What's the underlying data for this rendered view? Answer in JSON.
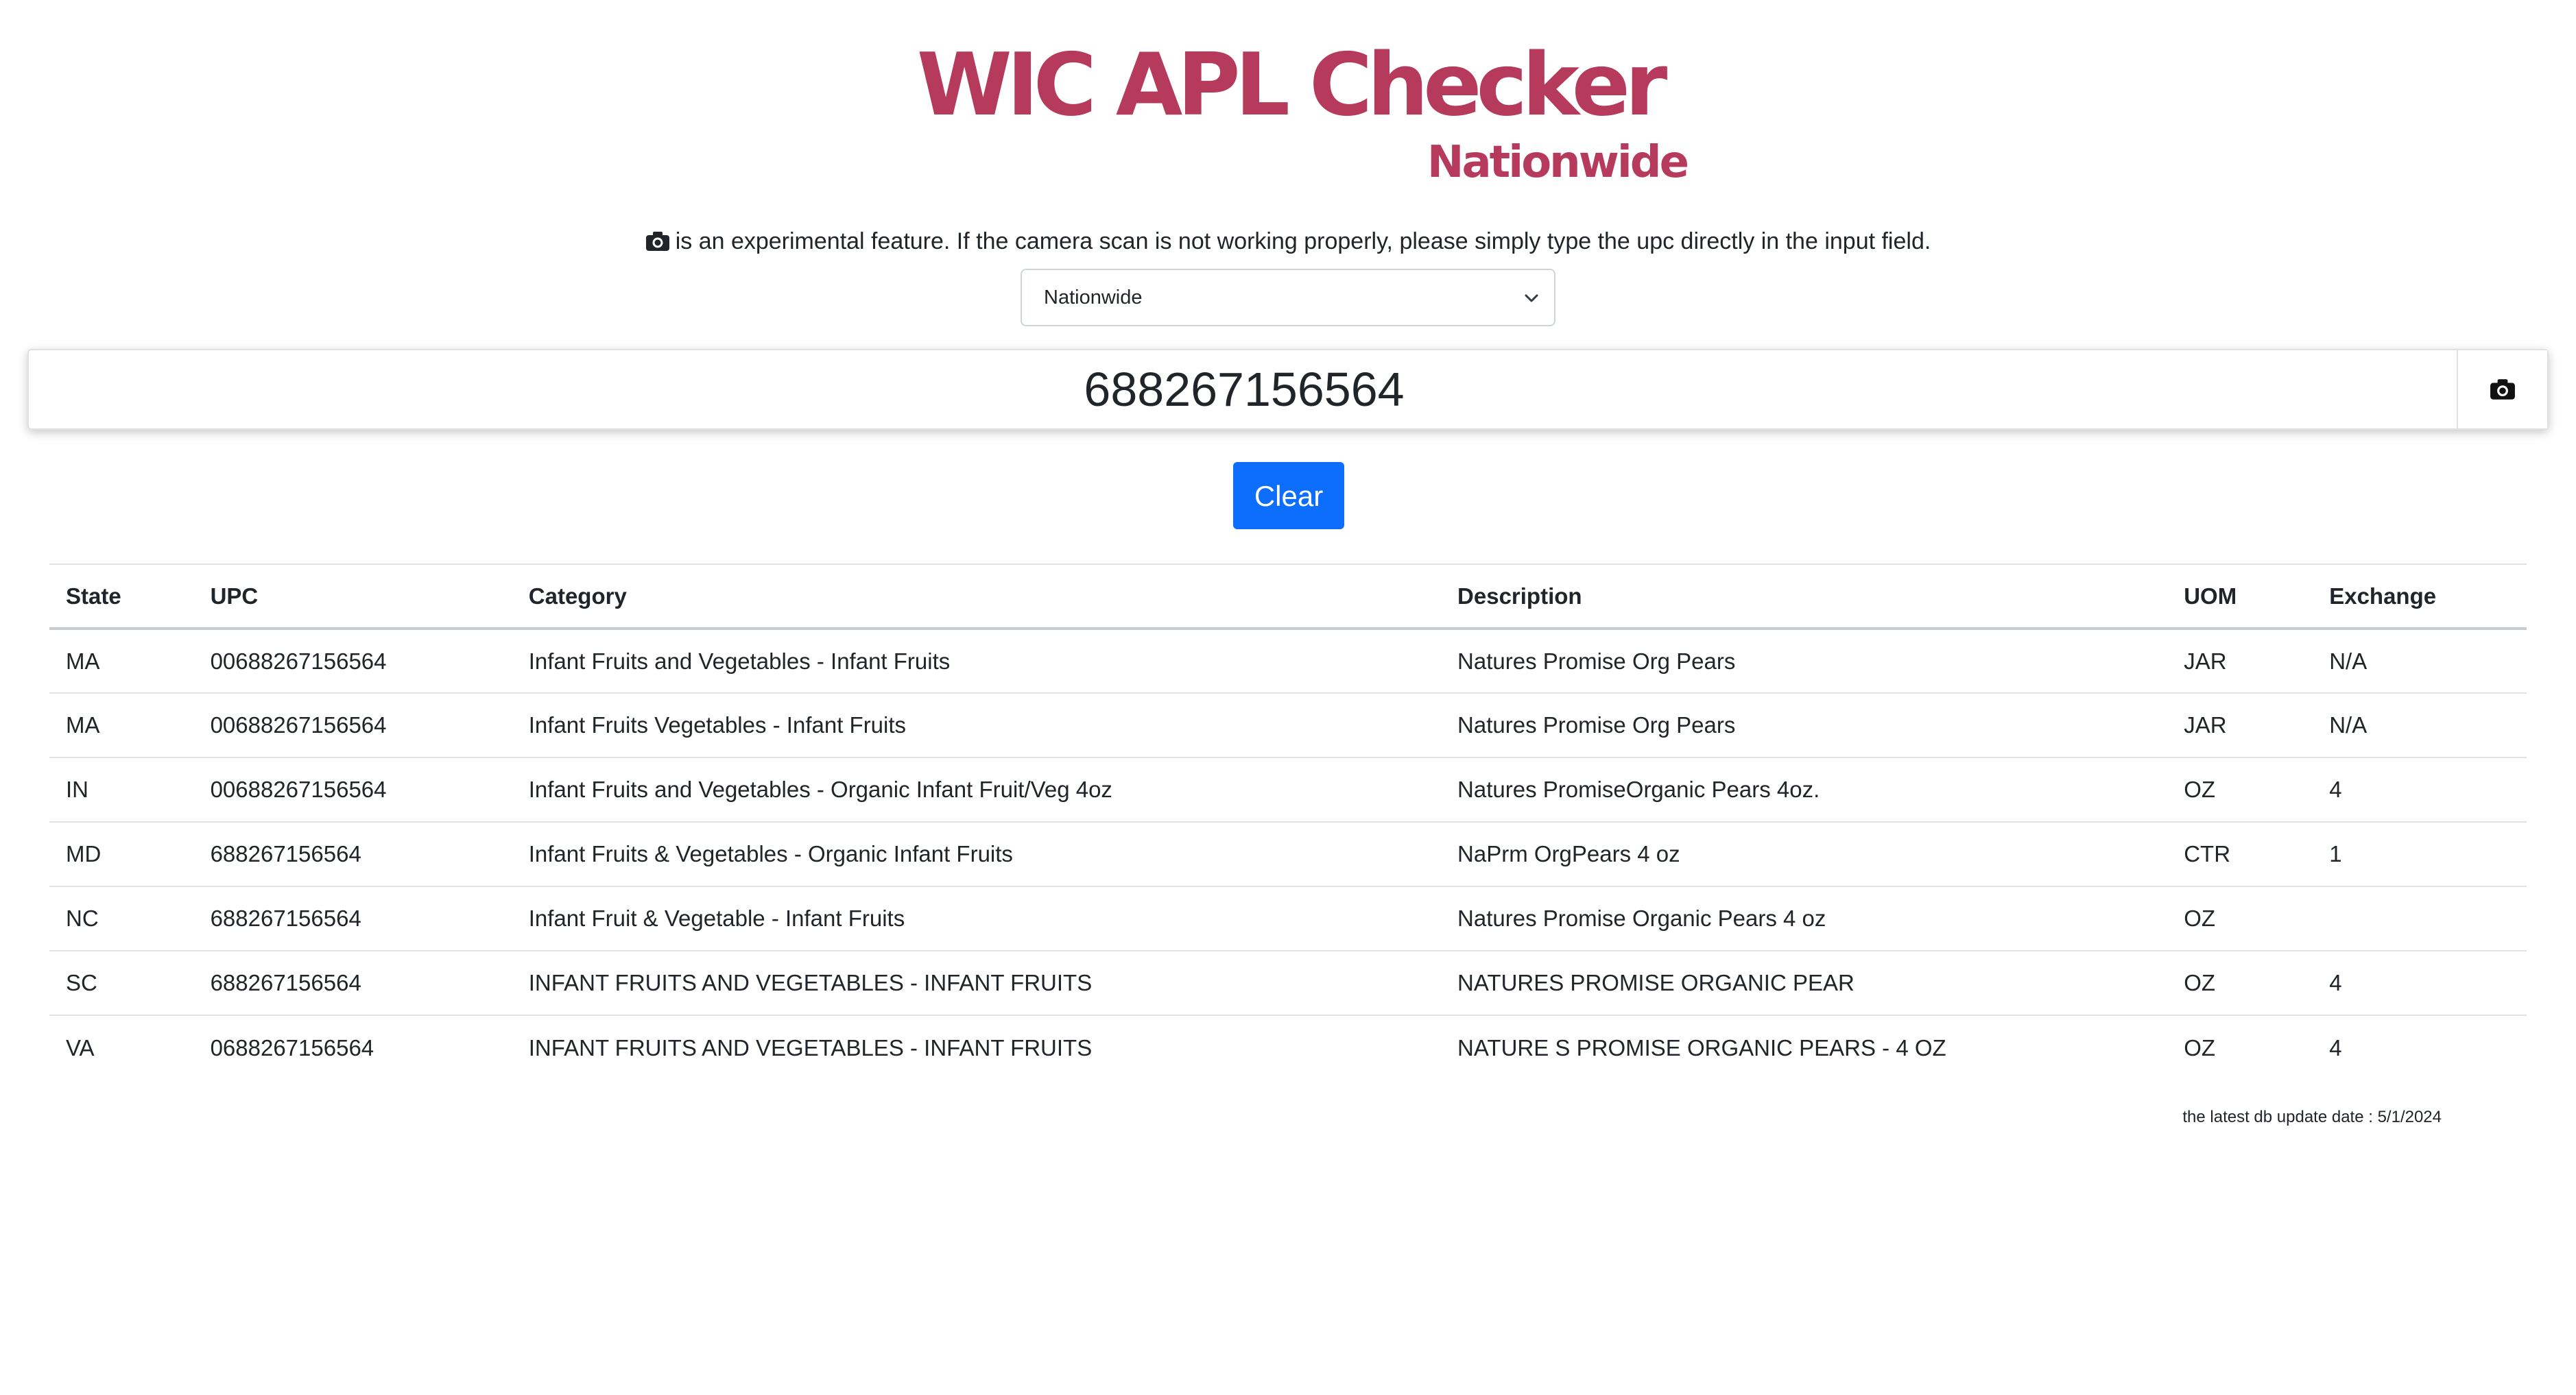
{
  "logo": {
    "title": "WIC APL Checker",
    "subtitle": "Nationwide",
    "color": "#b63a5b"
  },
  "notice": {
    "icon": "camera-icon",
    "text": "is an experimental feature. If the camera scan is not working properly, please simply type the upc directly in the input field."
  },
  "state_select": {
    "selected": "Nationwide",
    "icon": "chevron-down-icon"
  },
  "search": {
    "value": "688267156564",
    "camera_icon": "camera-icon"
  },
  "clear_button": {
    "label": "Clear",
    "color": "#0d6efd"
  },
  "table": {
    "headers": {
      "state": "State",
      "upc": "UPC",
      "category": "Category",
      "description": "Description",
      "uom": "UOM",
      "exchange": "Exchange"
    },
    "rows": [
      {
        "state": "MA",
        "upc": "00688267156564",
        "category": "Infant Fruits and Vegetables - Infant Fruits",
        "description": "Natures Promise Org Pears",
        "uom": "JAR",
        "exchange": "N/A"
      },
      {
        "state": "MA",
        "upc": "00688267156564",
        "category": "Infant Fruits Vegetables - Infant Fruits",
        "description": "Natures Promise Org Pears",
        "uom": "JAR",
        "exchange": "N/A"
      },
      {
        "state": "IN",
        "upc": "00688267156564",
        "category": "Infant Fruits and Vegetables - Organic Infant Fruit/Veg 4oz",
        "description": "Natures PromiseOrganic Pears 4oz.",
        "uom": "OZ",
        "exchange": "4"
      },
      {
        "state": "MD",
        "upc": "688267156564",
        "category": "Infant Fruits & Vegetables - Organic Infant Fruits",
        "description": "NaPrm OrgPears 4 oz",
        "uom": "CTR",
        "exchange": "1"
      },
      {
        "state": "NC",
        "upc": "688267156564",
        "category": "Infant Fruit & Vegetable - Infant Fruits",
        "description": "Natures Promise Organic Pears 4 oz",
        "uom": "OZ",
        "exchange": ""
      },
      {
        "state": "SC",
        "upc": "688267156564",
        "category": "INFANT FRUITS AND VEGETABLES - INFANT FRUITS",
        "description": "NATURES PROMISE ORGANIC PEAR",
        "uom": "OZ",
        "exchange": "4"
      },
      {
        "state": "VA",
        "upc": "0688267156564",
        "category": "INFANT FRUITS AND VEGETABLES - INFANT FRUITS",
        "description": "NATURE S PROMISE ORGANIC PEARS - 4 OZ",
        "uom": "OZ",
        "exchange": "4"
      }
    ]
  },
  "footer": {
    "db_update": "the latest db update date : 5/1/2024"
  }
}
